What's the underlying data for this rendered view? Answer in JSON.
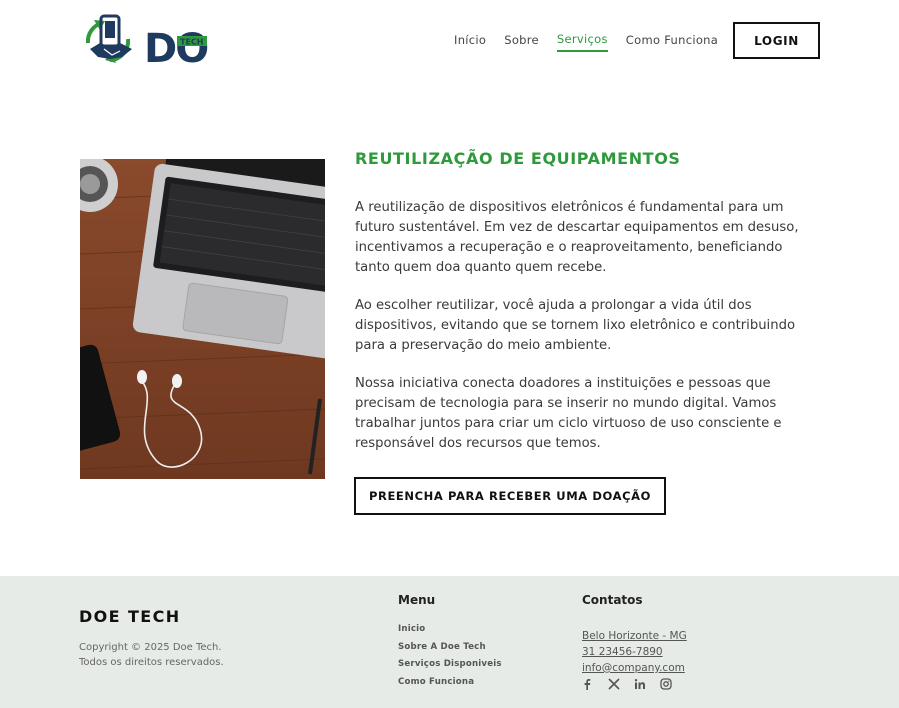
{
  "header": {
    "logo_text": "DOE",
    "logo_sub": "TECH",
    "nav": [
      {
        "label": "Início",
        "active": false
      },
      {
        "label": "Sobre",
        "active": false
      },
      {
        "label": "Serviços",
        "active": true
      },
      {
        "label": "Como Funciona",
        "active": false
      }
    ],
    "login_label": "LOGIN"
  },
  "main": {
    "title": "REUTILIZAÇÃO DE EQUIPAMENTOS",
    "paragraphs": [
      "A reutilização de dispositivos eletrônicos é fundamental para um futuro sustentável. Em vez de descartar equipamentos em desuso, incentivamos a recuperação e o reaproveitamento, beneficiando tanto quem doa quanto quem recebe.",
      "Ao escolher reutilizar, você ajuda a prolongar a vida útil dos dispositivos, evitando que se tornem lixo eletrônico e contribuindo para a preservação do meio ambiente.",
      "Nossa iniciativa conecta doadores a instituições e pessoas que precisam de tecnologia para se inserir no mundo digital. Vamos trabalhar juntos para criar um ciclo virtuoso de uso consciente e responsável dos recursos que temos."
    ],
    "cta_label": "PREENCHA PARA RECEBER UMA DOAÇÃO"
  },
  "footer": {
    "brand": "DOE TECH",
    "copyright_line1": "Copyright © 2025 Doe Tech.",
    "copyright_line2": "Todos os direitos reservados.",
    "menu_title": "Menu",
    "menu_items": [
      "Inicio",
      "Sobre A Doe Tech",
      "Serviços Disponiveis",
      "Como Funciona"
    ],
    "contacts_title": "Contatos",
    "contacts": [
      "Belo Horizonte - MG",
      "31 23456-7890",
      "info@company.com"
    ],
    "socials": [
      "facebook-icon",
      "x-icon",
      "linkedin-icon",
      "instagram-icon"
    ]
  },
  "colors": {
    "accent": "#2e9a3c",
    "logo_navy": "#1f3a5f",
    "footer_bg": "#e6ebe7"
  }
}
